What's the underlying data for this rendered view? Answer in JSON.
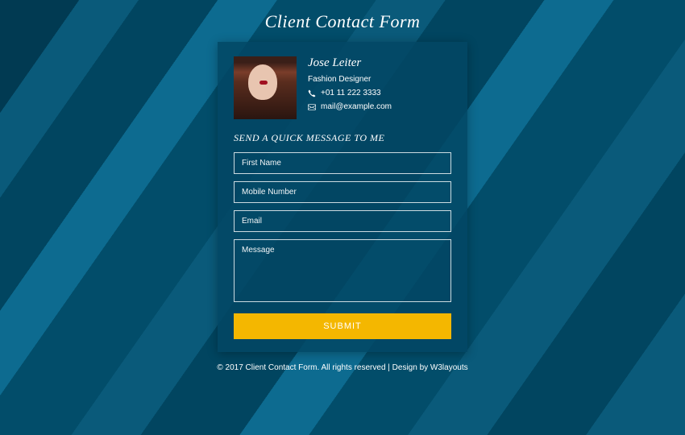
{
  "page": {
    "title": "Client Contact Form"
  },
  "profile": {
    "name": "Jose Leiter",
    "role": "Fashion Designer",
    "phone": "+01 11 222 3333",
    "email": "mail@example.com"
  },
  "form": {
    "title": "SEND A QUICK MESSAGE TO ME",
    "fields": {
      "first_name": {
        "placeholder": "First Name"
      },
      "mobile": {
        "placeholder": "Mobile Number"
      },
      "email": {
        "placeholder": "Email"
      },
      "message": {
        "placeholder": "Message"
      }
    },
    "submit_label": "SUBMIT"
  },
  "footer": {
    "copyright": "© 2017 Client Contact Form. All rights reserved | Design by ",
    "design_link": "W3layouts"
  },
  "colors": {
    "accent": "#f4b700"
  }
}
